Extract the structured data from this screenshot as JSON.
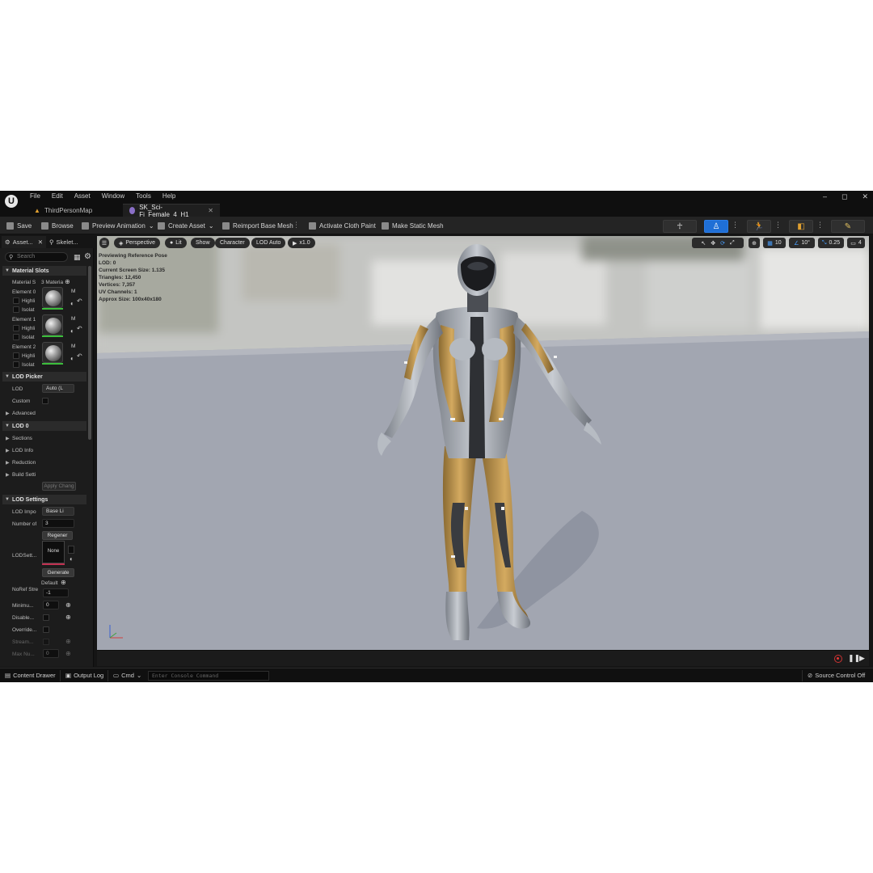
{
  "menu": [
    "File",
    "Edit",
    "Asset",
    "Window",
    "Tools",
    "Help"
  ],
  "window_controls": [
    "–",
    "◻",
    "✕"
  ],
  "tabs": [
    {
      "label": "ThirdPersonMap",
      "active": false
    },
    {
      "label": "SK_Sci-Fi_Female_4_H1",
      "active": true
    }
  ],
  "toolbar": {
    "save": "Save",
    "browse": "Browse",
    "preview_animation": "Preview Animation",
    "create_asset": "Create Asset",
    "reimport": "Reimport Base Mesh",
    "cloth_paint": "Activate Cloth Paint",
    "static_mesh": "Make Static Mesh"
  },
  "panel_tabs": [
    "Asset...",
    "Skelet..."
  ],
  "search_placeholder": "Search",
  "details": {
    "material_slots_header": "Material Slots",
    "material_slots_label": "Material S",
    "material_slots_value": "3 Materia",
    "elements": [
      "Element 0",
      "Element 1",
      "Element 2"
    ],
    "highlight": "Highli",
    "isolate": "Isolat",
    "mat_letter": "M",
    "lod_picker_header": "LOD Picker",
    "lod_label": "LOD",
    "lod_value": "Auto (L",
    "custom_label": "Custom",
    "advanced": "Advanced",
    "lod0_header": "LOD 0",
    "sections": "Sections",
    "lod_info": "LOD Info",
    "reduction": "Reduction",
    "build_settings": "Build Setti",
    "apply_changes": "Apply Chang",
    "lod_settings_header": "LOD Settings",
    "lod_import": "LOD Impo",
    "lod_import_value": "Base Li",
    "number_of": "Number of",
    "number_value": "3",
    "regen": "Regener",
    "lod_settings_label": "LODSett...",
    "none": "None",
    "generate": "Generate",
    "default": "Default",
    "noref": "NoRef Stre",
    "noref_value": "-1",
    "minimum": "Minimu...",
    "minimum_value": "0",
    "disable": "Disable...",
    "override": "Override...",
    "stream": "Stream...",
    "max_num": "Max Nu...",
    "max_value": "0"
  },
  "viewport": {
    "perspective": "Perspective",
    "lit": "Lit",
    "show": "Show",
    "character": "Character",
    "lod_auto": "LOD Auto",
    "speed": "x1.0",
    "grid_value": "10",
    "angle_value": "10°",
    "scale_value": "0.25",
    "cam_value": "4"
  },
  "stats": [
    "Previewing Reference Pose",
    "LOD: 0",
    "Current Screen Size: 1.135",
    "Triangles: 12,450",
    "Vertices: 7,357",
    "UV Channels: 1",
    "Approx Size: 100x40x180"
  ],
  "statusbar": {
    "content_drawer": "Content Drawer",
    "output_log": "Output Log",
    "cmd": "Cmd",
    "console_placeholder": "Enter Console Command",
    "source_control": "Source Control Off"
  },
  "colors": {
    "accent": "#1f6fd6",
    "suit_gold": "#c8a050",
    "suit_silver": "#a9aeb5"
  }
}
